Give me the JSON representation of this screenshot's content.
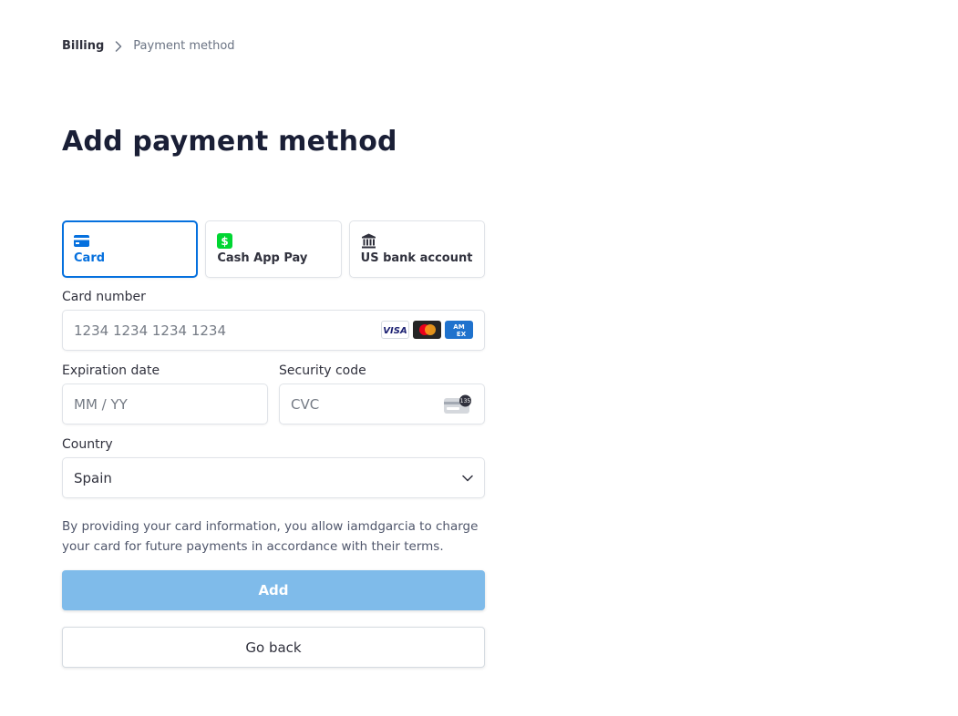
{
  "breadcrumb": {
    "parent": "Billing",
    "current": "Payment method"
  },
  "title": "Add payment method",
  "tabs": [
    {
      "label": "Card",
      "icon": "card-icon",
      "active": true
    },
    {
      "label": "Cash App Pay",
      "icon": "cash-app-icon",
      "active": false
    },
    {
      "label": "US bank account",
      "icon": "bank-icon",
      "active": false
    }
  ],
  "card_number": {
    "label": "Card number",
    "placeholder": "1234 1234 1234 1234",
    "brands": [
      "visa",
      "mastercard",
      "amex"
    ]
  },
  "expiry": {
    "label": "Expiration date",
    "placeholder": "MM / YY"
  },
  "cvc": {
    "label": "Security code",
    "placeholder": "CVC"
  },
  "country": {
    "label": "Country",
    "value": "Spain"
  },
  "notice": "By providing your card information, you allow iamdgarcia to charge your card for future payments in accordance with their terms.",
  "buttons": {
    "add": "Add",
    "back": "Go back"
  },
  "colors": {
    "accent": "#0570de",
    "add_button_disabled": "#7fbbea",
    "cash_app_green": "#00d632"
  }
}
